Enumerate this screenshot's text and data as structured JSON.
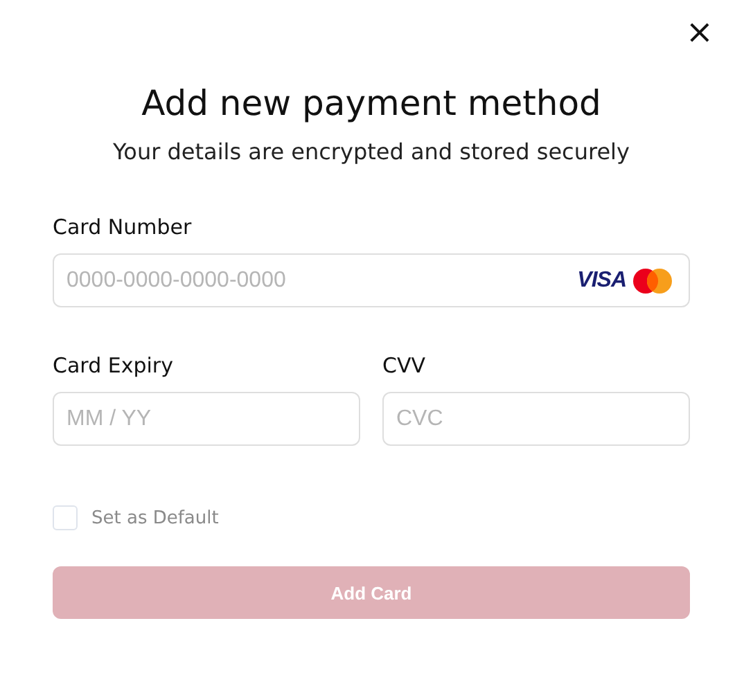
{
  "dialog": {
    "close": "×",
    "title": "Add new payment method",
    "subtitle": "Your details are encrypted and stored securely"
  },
  "fields": [
    {
      "kind": "card",
      "label": "Card Number",
      "placeholder": "0000-0000-0000-0000",
      "brand_text": "VISA"
    },
    {
      "kind": "half",
      "label": "Card Expiry",
      "placeholder": "MM / YY"
    },
    {
      "kind": "half",
      "label": "CVV",
      "placeholder": "CVC"
    }
  ],
  "default_checkbox": {
    "label": "Set as Default",
    "checked": false,
    "disabled": true
  },
  "submit": {
    "label": "Add Card",
    "disabled": true
  }
}
